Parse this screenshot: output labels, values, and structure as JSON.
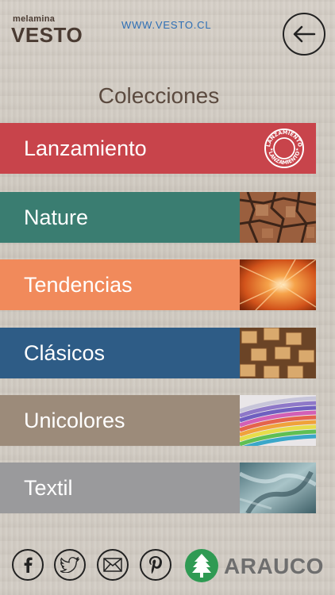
{
  "header": {
    "logo_top": "melamina",
    "logo_main": "VESTO",
    "site_link": "WWW.VESTO.CL"
  },
  "page_title": "Colecciones",
  "collections": [
    {
      "label": "Lanzamiento",
      "color": "#c8444b",
      "thumb": "lanzamiento-seal-icon"
    },
    {
      "label": "Nature",
      "color": "#3a7d71",
      "thumb": "bark-texture-image"
    },
    {
      "label": "Tendencias",
      "color": "#f18a5b",
      "thumb": "orange-burst-image"
    },
    {
      "label": "Clásicos",
      "color": "#2e5c86",
      "thumb": "wood-blocks-image"
    },
    {
      "label": "Unicolores",
      "color": "#9c8b7a",
      "thumb": "color-swatches-image"
    },
    {
      "label": "Textil",
      "color": "#9a9a9c",
      "thumb": "fabric-image"
    }
  ],
  "seal_text": "LANZAMIENTO",
  "footer": {
    "brand": "ARAUCO",
    "social": [
      "facebook-icon",
      "twitter-icon",
      "email-icon",
      "pinterest-icon"
    ]
  }
}
